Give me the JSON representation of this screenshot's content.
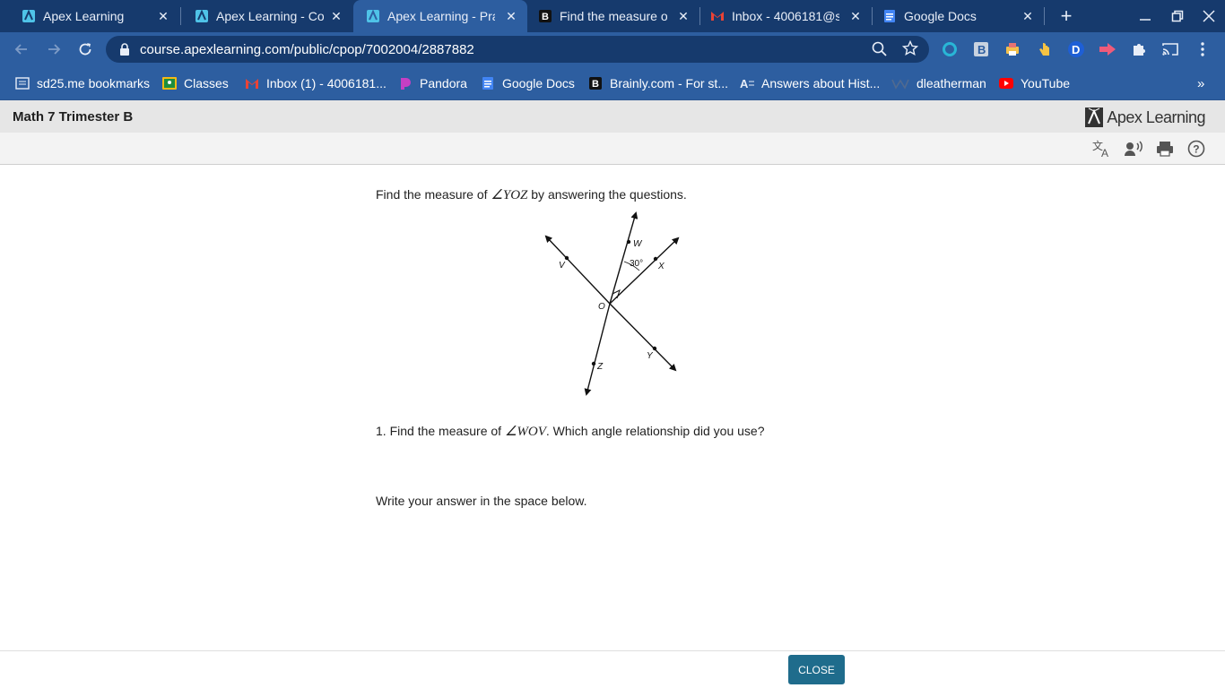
{
  "tabs": [
    {
      "title": "Apex Learning",
      "favicon": "apex-icon"
    },
    {
      "title": "Apex Learning - Cour",
      "favicon": "apex-icon"
    },
    {
      "title": "Apex Learning - Prac",
      "favicon": "apex-icon",
      "active": true
    },
    {
      "title": "Find the measure of",
      "favicon": "brainly-icon"
    },
    {
      "title": "Inbox - 4006181@sd",
      "favicon": "gmail-icon"
    },
    {
      "title": "Google Docs",
      "favicon": "google-docs-icon"
    }
  ],
  "new_tab_label": "+",
  "address_bar": {
    "url": "course.apexlearning.com/public/cpop/7002004/2887882"
  },
  "bookmarks": [
    {
      "label": "sd25.me bookmarks",
      "icon": "folder-icon"
    },
    {
      "label": "Classes",
      "icon": "classroom-icon"
    },
    {
      "label": "Inbox (1) - 4006181...",
      "icon": "gmail-icon"
    },
    {
      "label": "Pandora",
      "icon": "pandora-icon"
    },
    {
      "label": "Google Docs",
      "icon": "google-docs-icon"
    },
    {
      "label": "Brainly.com - For st...",
      "icon": "brainly-icon"
    },
    {
      "label": "Answers about Hist...",
      "icon": "answers-icon"
    },
    {
      "label": "dleatherman",
      "icon": "profile-icon"
    },
    {
      "label": "YouTube",
      "icon": "youtube-icon"
    }
  ],
  "bookmarks_overflow": "»",
  "page": {
    "course_title": "Math 7 Trimester B",
    "logo_text": "Apex Learning",
    "prompt": {
      "before": "Find the measure of ",
      "angle": "∠YOZ",
      "after": " by answering the questions."
    },
    "question1": {
      "before": "1. Find the measure of ",
      "angle": "∠WOV",
      "after": ". Which angle relationship did you use?"
    },
    "instruction": "Write your answer in the space below.",
    "close_label": "CLOSE"
  },
  "diagram": {
    "labels": {
      "W": "W",
      "X": "X",
      "V": "V",
      "O": "O",
      "Y": "Y",
      "Z": "Z",
      "angle": "30°"
    }
  },
  "colors": {
    "tab_strip": "#163a6d",
    "toolbar": "#2d5ea0",
    "close_button": "#1f6c8c"
  }
}
